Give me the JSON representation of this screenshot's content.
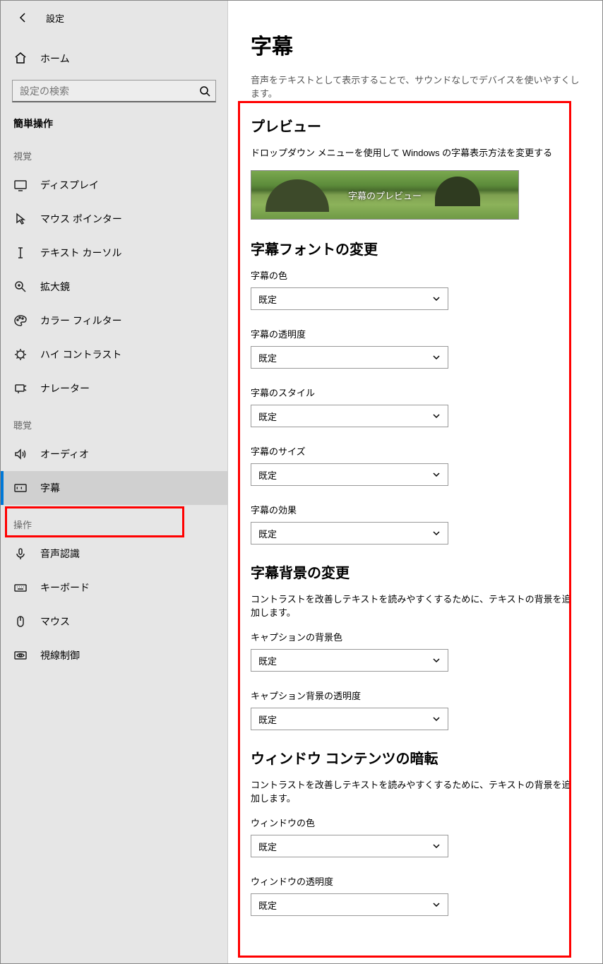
{
  "header": {
    "title": "設定"
  },
  "sidebar": {
    "home_label": "ホーム",
    "search_placeholder": "設定の検索",
    "group_main": "簡単操作",
    "groups": [
      {
        "title": "視覚",
        "items": [
          {
            "id": "display",
            "label": "ディスプレイ"
          },
          {
            "id": "mouse-pointer",
            "label": "マウス ポインター"
          },
          {
            "id": "text-cursor",
            "label": "テキスト カーソル"
          },
          {
            "id": "magnifier",
            "label": "拡大鏡"
          },
          {
            "id": "color-filter",
            "label": "カラー フィルター"
          },
          {
            "id": "high-contrast",
            "label": "ハイ コントラスト"
          },
          {
            "id": "narrator",
            "label": "ナレーター"
          }
        ]
      },
      {
        "title": "聴覚",
        "items": [
          {
            "id": "audio",
            "label": "オーディオ"
          },
          {
            "id": "captions",
            "label": "字幕",
            "active": true
          }
        ]
      },
      {
        "title": "操作",
        "items": [
          {
            "id": "speech",
            "label": "音声認識"
          },
          {
            "id": "keyboard",
            "label": "キーボード"
          },
          {
            "id": "mouse",
            "label": "マウス"
          },
          {
            "id": "eye-control",
            "label": "視線制御"
          }
        ]
      }
    ]
  },
  "main": {
    "title": "字幕",
    "subtitle": "音声をテキストとして表示することで、サウンドなしでデバイスを使いやすくします。",
    "preview_heading": "プレビュー",
    "preview_desc": "ドロップダウン メニューを使用して Windows の字幕表示方法を変更する",
    "preview_caption": "字幕のプレビュー",
    "font_heading": "字幕フォントの変更",
    "fields_font": [
      {
        "label": "字幕の色",
        "value": "既定"
      },
      {
        "label": "字幕の透明度",
        "value": "既定"
      },
      {
        "label": "字幕のスタイル",
        "value": "既定"
      },
      {
        "label": "字幕のサイズ",
        "value": "既定"
      },
      {
        "label": "字幕の効果",
        "value": "既定"
      }
    ],
    "bg_heading": "字幕背景の変更",
    "bg_desc": "コントラストを改善しテキストを読みやすくするために、テキストの背景を追加します。",
    "fields_bg": [
      {
        "label": "キャプションの背景色",
        "value": "既定"
      },
      {
        "label": "キャプション背景の透明度",
        "value": "既定"
      }
    ],
    "dim_heading": "ウィンドウ コンテンツの暗転",
    "dim_desc": "コントラストを改善しテキストを読みやすくするために、テキストの背景を追加します。",
    "fields_dim": [
      {
        "label": "ウィンドウの色",
        "value": "既定"
      },
      {
        "label": "ウィンドウの透明度",
        "value": "既定"
      }
    ]
  }
}
